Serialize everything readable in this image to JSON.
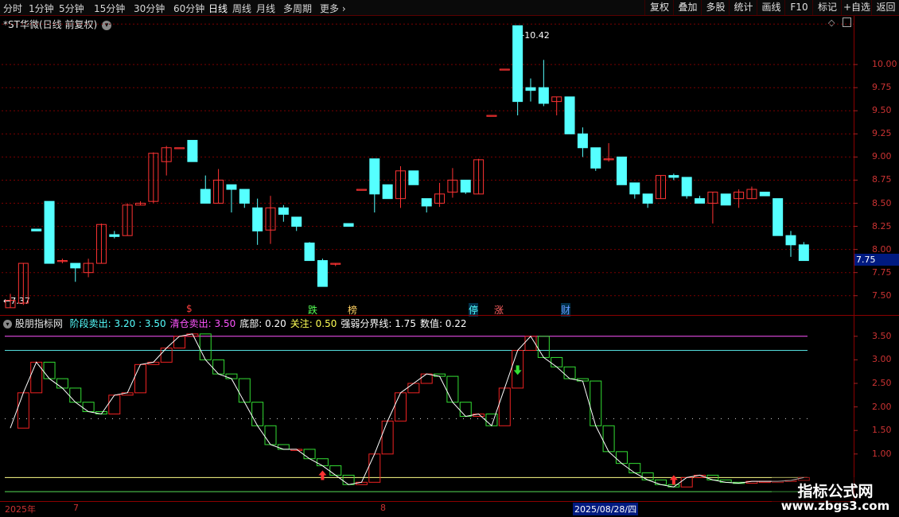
{
  "toolbar": {
    "periods": [
      "分时",
      "1分钟",
      "5分钟",
      "15分钟",
      "30分钟",
      "60分钟",
      "日线",
      "周线",
      "月线",
      "多周期",
      "更多"
    ],
    "active_period": "日线",
    "buttons": [
      "复权",
      "叠加",
      "多股",
      "统计",
      "画线",
      "F10",
      "标记",
      "+自选",
      "返回"
    ]
  },
  "stock_title": "*ST华微(日线 前复权)",
  "price_labels": {
    "high": "10.42",
    "low": "7.37",
    "current": "7.75"
  },
  "price_axis": [
    "10.00",
    "9.75",
    "9.50",
    "9.25",
    "9.00",
    "8.75",
    "8.50",
    "8.25",
    "8.00",
    "7.75",
    "7.50"
  ],
  "event_markers": [
    {
      "text": "$",
      "color": "#ff4040"
    },
    {
      "text": "跌",
      "color": "#55ff55"
    },
    {
      "text": "榜",
      "color": "#ffd060"
    },
    {
      "text": "停",
      "color": "#55ffff"
    },
    {
      "text": "涨",
      "color": "#ff6060"
    },
    {
      "text": "财",
      "color": "#6699ff"
    }
  ],
  "indicator": {
    "name": "股朋指标网",
    "items": [
      {
        "label": "阶段卖出:",
        "value": "3.20 : 3.50",
        "color": "#55ffff"
      },
      {
        "label": "清仓卖出:",
        "value": "3.50",
        "color": "#ff55ff"
      },
      {
        "label": "底部:",
        "value": "0.20",
        "color": "#ffffff"
      },
      {
        "label": "关注:",
        "value": "0.50",
        "color": "#ffff55"
      },
      {
        "label": "强弱分界线:",
        "value": "1.75",
        "color": "#ffffff"
      },
      {
        "label": "数值:",
        "value": "0.22",
        "color": "#ffffff"
      }
    ],
    "axis": [
      "3.50",
      "3.00",
      "2.50",
      "2.00",
      "1.50",
      "1.00"
    ]
  },
  "date_axis": {
    "left": "2025年",
    "m7": "7",
    "m8": "8",
    "cursor": "2025/08/28/四"
  },
  "watermark": {
    "line1": "指标公式网",
    "line2": "www.zbgs3.com"
  },
  "chart_data": {
    "type": "candlestick",
    "title": "*ST华微(日线 前复权)",
    "up_color": "#ff3333",
    "down_color": "#55ffff",
    "ohlc": [
      [
        7.37,
        7.52,
        7.37,
        7.45
      ],
      [
        7.42,
        7.85,
        7.4,
        7.85
      ],
      [
        8.22,
        8.22,
        8.2,
        8.2
      ],
      [
        8.52,
        8.52,
        7.85,
        7.85
      ],
      [
        7.88,
        7.9,
        7.85,
        7.88
      ],
      [
        7.85,
        7.85,
        7.65,
        7.8
      ],
      [
        7.75,
        7.9,
        7.7,
        7.85
      ],
      [
        7.85,
        8.28,
        7.85,
        8.27
      ],
      [
        8.16,
        8.2,
        8.12,
        8.14
      ],
      [
        8.15,
        8.5,
        8.15,
        8.48
      ],
      [
        8.48,
        8.52,
        8.48,
        8.5
      ],
      [
        8.52,
        9.05,
        8.5,
        9.04
      ],
      [
        8.95,
        9.12,
        8.8,
        9.1
      ],
      [
        9.1,
        9.1,
        9.1,
        9.1
      ],
      [
        9.18,
        9.18,
        8.95,
        8.95
      ],
      [
        8.65,
        8.8,
        8.5,
        8.5
      ],
      [
        8.5,
        8.87,
        8.5,
        8.75
      ],
      [
        8.7,
        8.7,
        8.4,
        8.65
      ],
      [
        8.65,
        8.65,
        8.45,
        8.5
      ],
      [
        8.45,
        8.55,
        8.05,
        8.2
      ],
      [
        8.21,
        8.58,
        8.06,
        8.45
      ],
      [
        8.45,
        8.48,
        8.3,
        8.38
      ],
      [
        8.35,
        8.35,
        8.2,
        8.25
      ],
      [
        8.07,
        8.08,
        7.9,
        7.88
      ],
      [
        7.88,
        7.9,
        7.6,
        7.6
      ],
      [
        7.85,
        7.85,
        7.82,
        7.85
      ],
      [
        8.28,
        8.28,
        8.25,
        8.25
      ],
      [
        8.65,
        8.65,
        8.65,
        8.65
      ],
      [
        8.98,
        8.98,
        8.4,
        8.6
      ],
      [
        8.7,
        8.7,
        8.55,
        8.55
      ],
      [
        8.55,
        8.9,
        8.45,
        8.85
      ],
      [
        8.85,
        8.85,
        8.7,
        8.7
      ],
      [
        8.55,
        8.55,
        8.4,
        8.47
      ],
      [
        8.5,
        8.72,
        8.46,
        8.6
      ],
      [
        8.62,
        8.88,
        8.56,
        8.75
      ],
      [
        8.75,
        8.75,
        8.6,
        8.62
      ],
      [
        8.6,
        8.98,
        8.6,
        8.97
      ],
      [
        9.45,
        9.45,
        9.45,
        9.45
      ],
      [
        9.95,
        9.95,
        9.95,
        9.95
      ],
      [
        10.42,
        10.42,
        9.45,
        9.6
      ],
      [
        9.75,
        9.85,
        9.6,
        9.72
      ],
      [
        9.75,
        10.05,
        9.55,
        9.58
      ],
      [
        9.6,
        9.65,
        9.45,
        9.65
      ],
      [
        9.65,
        9.65,
        9.25,
        9.25
      ],
      [
        9.25,
        9.32,
        9.0,
        9.1
      ],
      [
        9.1,
        9.1,
        8.85,
        8.88
      ],
      [
        8.98,
        9.15,
        8.95,
        8.98
      ],
      [
        9.0,
        9.0,
        8.7,
        8.7
      ],
      [
        8.72,
        8.72,
        8.55,
        8.6
      ],
      [
        8.6,
        8.6,
        8.45,
        8.5
      ],
      [
        8.55,
        8.8,
        8.55,
        8.8
      ],
      [
        8.8,
        8.82,
        8.75,
        8.78
      ],
      [
        8.78,
        8.78,
        8.55,
        8.58
      ],
      [
        8.55,
        8.58,
        8.5,
        8.5
      ],
      [
        8.5,
        8.62,
        8.28,
        8.62
      ],
      [
        8.6,
        8.6,
        8.5,
        8.48
      ],
      [
        8.55,
        8.65,
        8.45,
        8.62
      ],
      [
        8.55,
        8.68,
        8.55,
        8.65
      ],
      [
        8.62,
        8.62,
        8.58,
        8.58
      ],
      [
        8.55,
        8.55,
        8.15,
        8.15
      ],
      [
        8.15,
        8.2,
        7.92,
        8.05
      ],
      [
        8.05,
        8.08,
        7.9,
        7.88
      ]
    ],
    "indicator_values": [
      1.55,
      2.3,
      2.95,
      2.6,
      2.4,
      2.1,
      1.9,
      1.85,
      2.25,
      2.3,
      2.9,
      2.95,
      3.25,
      3.5,
      3.55,
      3.0,
      2.7,
      2.6,
      2.1,
      1.6,
      1.2,
      1.1,
      1.1,
      0.9,
      0.75,
      0.55,
      0.35,
      0.4,
      1.0,
      1.7,
      2.3,
      2.5,
      2.7,
      2.65,
      2.1,
      1.8,
      1.85,
      1.6,
      2.4,
      3.2,
      3.5,
      3.05,
      2.85,
      2.6,
      2.55,
      1.6,
      1.05,
      0.8,
      0.6,
      0.45,
      0.35,
      0.3,
      0.5,
      0.55,
      0.45,
      0.4,
      0.38,
      0.42,
      0.42,
      0.42,
      0.44,
      0.5
    ],
    "reference_lines": {
      "清仓卖出": 3.5,
      "阶段卖出": 3.2,
      "关注": 0.5,
      "底部": 0.2,
      "强弱分界线": 1.75
    },
    "ylim_price": [
      7.3,
      10.5
    ],
    "ylim_indicator": [
      0,
      3.75
    ]
  }
}
